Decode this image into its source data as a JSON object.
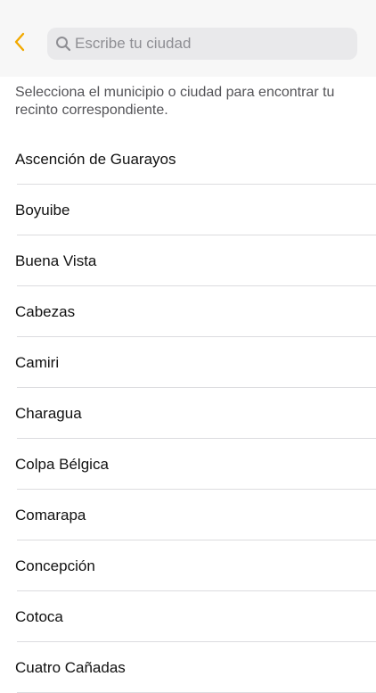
{
  "header": {
    "search_placeholder": "Escribe tu ciudad",
    "search_value": ""
  },
  "icons": {
    "back": "chevron-left-icon",
    "search": "magnifying-glass-icon"
  },
  "colors": {
    "accent": "#F2A900",
    "placeholder": "#8E8E93",
    "search_bg": "#E9E9EB",
    "topbar_bg": "#F7F7F7"
  },
  "instructions": "Selecciona el municipio o ciudad para encontrar tu recinto correspondiente.",
  "cities": [
    "Ascención de Guarayos",
    "Boyuibe",
    "Buena Vista",
    "Cabezas",
    "Camiri",
    "Charagua",
    "Colpa Bélgica",
    "Comarapa",
    "Concepción",
    "Cotoca",
    "Cuatro Cañadas"
  ]
}
